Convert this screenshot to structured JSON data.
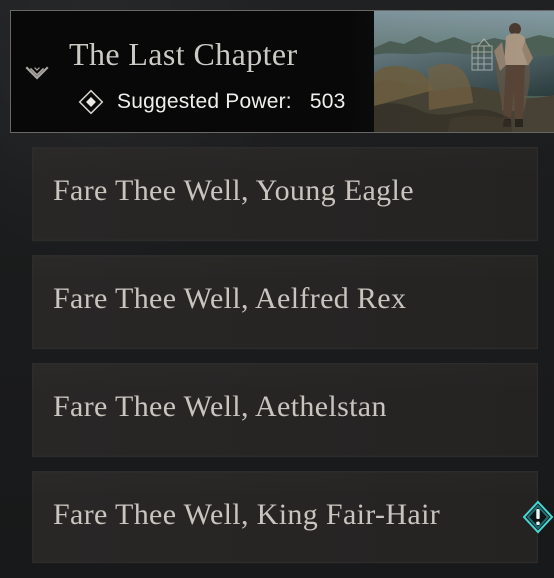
{
  "header": {
    "title": "The Last Chapter",
    "suggested_power_label": "Suggested Power:",
    "suggested_power_value": "503",
    "icons": {
      "collapse": "chevron-down-icon",
      "power": "diamond-icon",
      "art": "quest-banner-illustration"
    }
  },
  "quests": [
    {
      "label": "Fare Thee Well, Young Eagle"
    },
    {
      "label": "Fare Thee Well, Aelfred Rex"
    },
    {
      "label": "Fare Thee Well, Aethelstan"
    },
    {
      "label": "Fare Thee Well, King Fair-Hair"
    }
  ],
  "alert": {
    "icon": "alert-icon",
    "accent": "#45d8d6"
  },
  "colors": {
    "background": "#1b1c1d",
    "header_border": "#6a6864",
    "card_bg": "#272524",
    "text_primary": "#c8c4be",
    "text_bright": "#f0efeb"
  }
}
